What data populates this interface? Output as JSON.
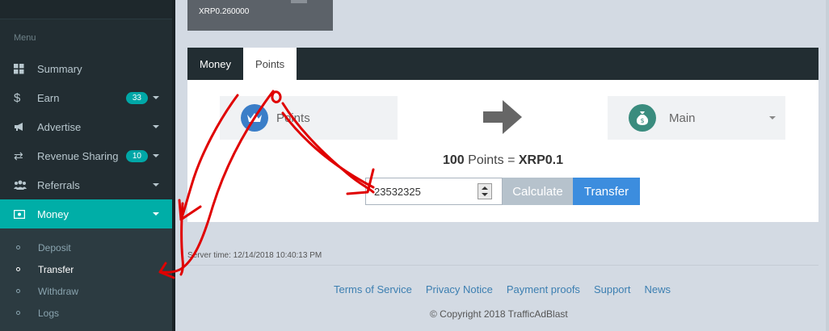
{
  "sidebar": {
    "menu_header": "Menu",
    "items": [
      {
        "label": "Summary",
        "icon": "dashboard-icon"
      },
      {
        "label": "Earn",
        "icon": "dollar-icon",
        "badge": "33"
      },
      {
        "label": "Advertise",
        "icon": "bullhorn-icon"
      },
      {
        "label": "Revenue Sharing",
        "icon": "exchange-icon",
        "badge": "10"
      },
      {
        "label": "Referrals",
        "icon": "users-icon"
      },
      {
        "label": "Money",
        "icon": "money-icon",
        "active": true
      }
    ],
    "subitems": [
      {
        "label": "Deposit"
      },
      {
        "label": "Transfer",
        "current": true
      },
      {
        "label": "Withdraw"
      },
      {
        "label": "Logs"
      }
    ]
  },
  "top_card": {
    "value": "XRP0.260000"
  },
  "panel": {
    "tabs": [
      {
        "label": "Money"
      },
      {
        "label": "Points",
        "active": true
      }
    ],
    "from_wallet": {
      "label": "Points",
      "icon": "crown-icon"
    },
    "to_wallet": {
      "label": "Main",
      "icon": "money-bag-icon"
    },
    "rate": {
      "points_amount": "100",
      "points_unit": "Points",
      "equals": "=",
      "xrp_value": "XRP0.1"
    },
    "amount_input": {
      "value": "23532325"
    },
    "calculate_label": "Calculate",
    "transfer_label": "Transfer"
  },
  "server_time": "Server time: 12/14/2018 10:40:13 PM",
  "footer": {
    "links": [
      "Terms of Service",
      "Privacy Notice",
      "Payment proofs",
      "Support",
      "News"
    ],
    "copyright": "© Copyright 2018 TrafficAdBlast"
  },
  "colors": {
    "sidebar_bg": "#222d32",
    "accent": "#00aea7",
    "transfer_button": "#3c8dde",
    "annotation_red": "#e00000"
  }
}
